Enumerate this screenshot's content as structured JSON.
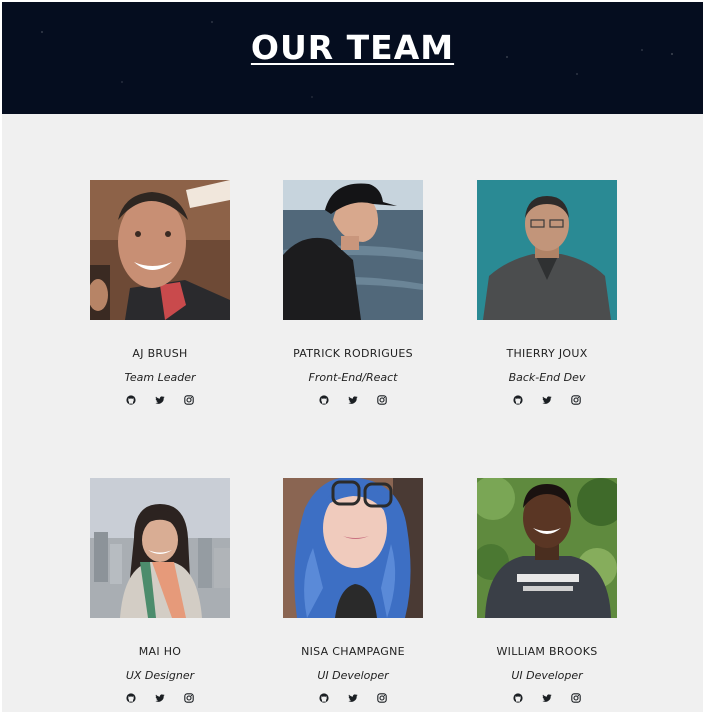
{
  "header": {
    "title": "OUR TEAM"
  },
  "team": [
    {
      "name": "AJ BRUSH",
      "role": "Team Leader"
    },
    {
      "name": "PATRICK RODRIGUES",
      "role": "Front-End/React"
    },
    {
      "name": "THIERRY JOUX",
      "role": "Back-End Dev"
    },
    {
      "name": "MAI HO",
      "role": "UX Designer"
    },
    {
      "name": "NISA CHAMPAGNE",
      "role": "UI Developer"
    },
    {
      "name": "WILLIAM BROOKS",
      "role": "UI Developer"
    }
  ],
  "icons": [
    "github-icon",
    "twitter-icon",
    "instagram-icon"
  ],
  "colors": {
    "header_bg": "#050d1f",
    "page_bg": "#f0f0f0",
    "text": "#222222"
  }
}
